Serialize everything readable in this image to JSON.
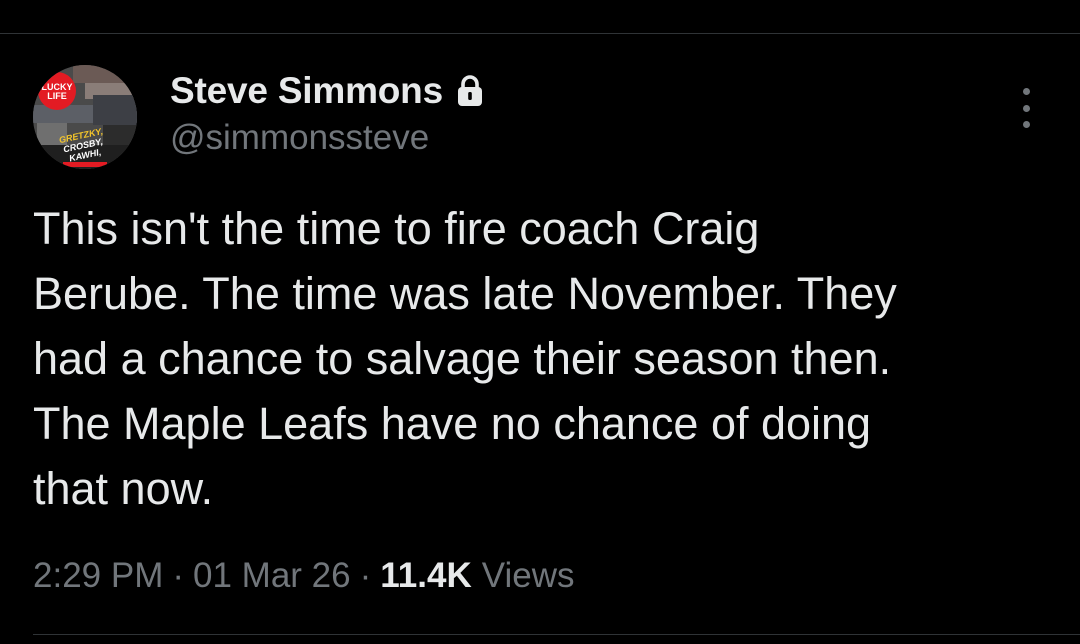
{
  "tweet": {
    "author": {
      "display_name": "Steve Simmons",
      "handle": "@simmonssteve",
      "protected_icon": "lock-icon",
      "avatar": {
        "badge_text": [
          "LUCKY",
          "LIFE"
        ],
        "cover_text": [
          "GRETZKY,",
          "CROSBY,",
          "KAWHI,"
        ]
      }
    },
    "more_icon": "more-vertical-icon",
    "text_lines": [
      "This isn't the time to fire coach Craig",
      "Berube. The time was late November. They",
      "had a chance to salvage their season then.",
      "The Maple Leafs have no chance of doing",
      "that now."
    ],
    "meta": {
      "time": "2:29 PM",
      "separator": "·",
      "date": "01 Mar 26",
      "views_count": "11.4K",
      "views_label": "Views"
    }
  },
  "colors": {
    "background": "#000000",
    "primary_text": "#e7e9ea",
    "secondary_text": "#71767b",
    "divider": "#2f3336"
  }
}
